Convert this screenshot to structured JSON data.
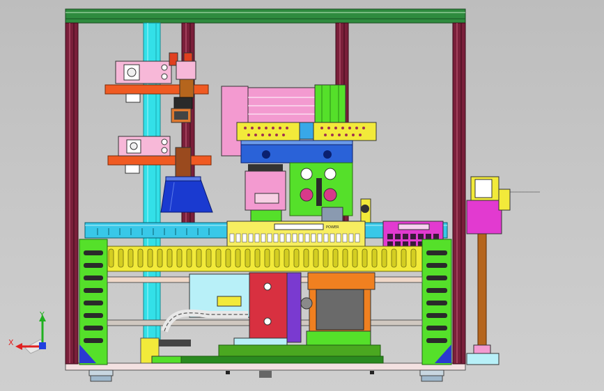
{
  "view": {
    "background": "#c6c6c6",
    "triad": {
      "x_label": "X",
      "y_label": "Y"
    },
    "panel_label": "POWER"
  },
  "colors": {
    "frame_post": "#7a1f3a",
    "frame_top": "#2e8b3e",
    "column_cyan": "#33e0e8",
    "orange_bar": "#f05a22",
    "pink": "#f39ad0",
    "yellow": "#f2ea3a",
    "green_cage": "#55e02a",
    "blue": "#2a62d8",
    "magenta": "#e23ad0",
    "red": "#d83040",
    "axis_x": "#e02020",
    "axis_y": "#20b020",
    "axis_z": "#2040e0"
  }
}
